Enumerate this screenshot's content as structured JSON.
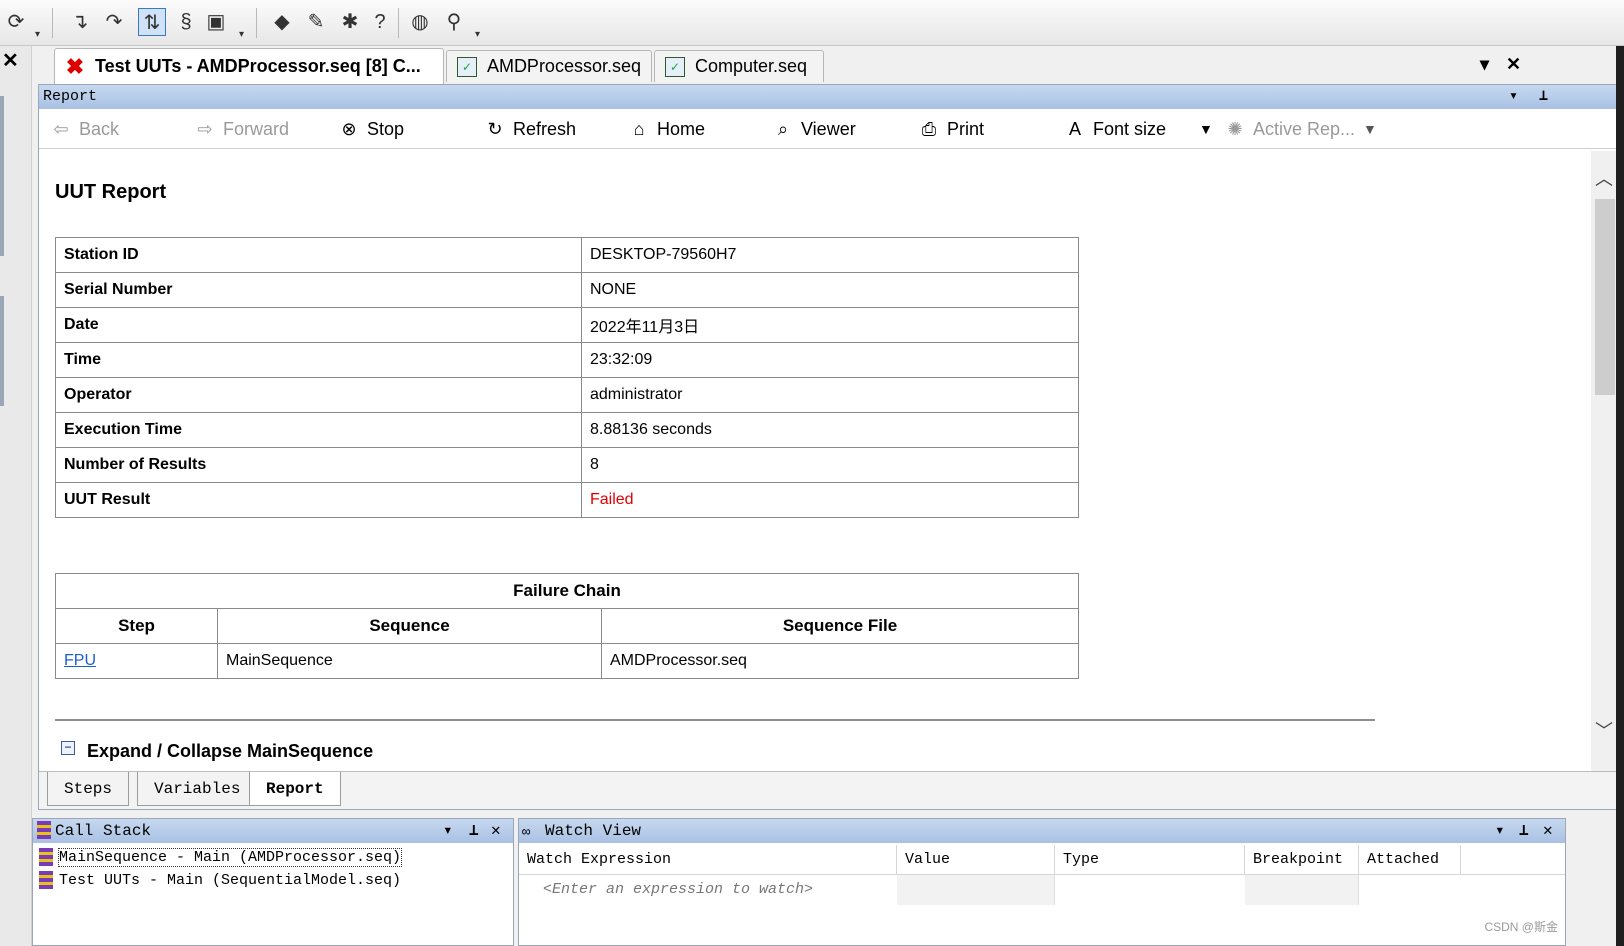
{
  "document_tabs": [
    {
      "label": "Test UUTs - AMDProcessor.seq [8]  C...",
      "active": true
    },
    {
      "label": "AMDProcessor.seq",
      "active": false
    },
    {
      "label": "Computer.seq",
      "active": false
    }
  ],
  "report_pane": {
    "title": "Report",
    "nav": {
      "back": "Back",
      "forward": "Forward",
      "stop": "Stop",
      "refresh": "Refresh",
      "home": "Home",
      "viewer": "Viewer",
      "print": "Print",
      "font_size": "Font size",
      "active_report": "Active Rep..."
    },
    "heading": "UUT Report",
    "info_rows": [
      {
        "key": "Station ID",
        "value": "DESKTOP-79560H7"
      },
      {
        "key": "Serial Number",
        "value": "NONE"
      },
      {
        "key": "Date",
        "value": "2022年11月3日"
      },
      {
        "key": "Time",
        "value": "23:32:09"
      },
      {
        "key": "Operator",
        "value": "administrator"
      },
      {
        "key": "Execution Time",
        "value": "8.88136 seconds"
      },
      {
        "key": "Number of Results",
        "value": "8"
      },
      {
        "key": "UUT Result",
        "value": "Failed"
      }
    ],
    "failure_chain": {
      "title": "Failure Chain",
      "columns": [
        "Step",
        "Sequence",
        "Sequence File"
      ],
      "rows": [
        {
          "step": "FPU",
          "sequence": "MainSequence",
          "sequence_file": "AMDProcessor.seq"
        }
      ]
    },
    "expand_label": "Expand / Collapse MainSequence",
    "bottom_tabs": [
      {
        "label": "Steps",
        "active": false
      },
      {
        "label": "Variables",
        "active": false
      },
      {
        "label": "Report",
        "active": true
      }
    ]
  },
  "call_stack": {
    "title": "Call Stack",
    "items": [
      "MainSequence - Main (AMDProcessor.seq)",
      "Test UUTs - Main (SequentialModel.seq)"
    ]
  },
  "watch_view": {
    "title": "Watch View",
    "columns": [
      "Watch Expression",
      "Value",
      "Type",
      "Breakpoint",
      "Attached"
    ],
    "placeholder": "<Enter an expression to watch>"
  },
  "watermark": "CSDN @斯金",
  "colors": {
    "failed": "#e00000",
    "link": "#1a5fd0",
    "pane_title": "#a9c1e4"
  },
  "icons": {
    "refresh_tool": "refresh-cycle-icon",
    "run_mode": "step-into-icon",
    "close": "close-icon",
    "dropdown": "chevron-down-icon",
    "pin": "pin-icon"
  }
}
